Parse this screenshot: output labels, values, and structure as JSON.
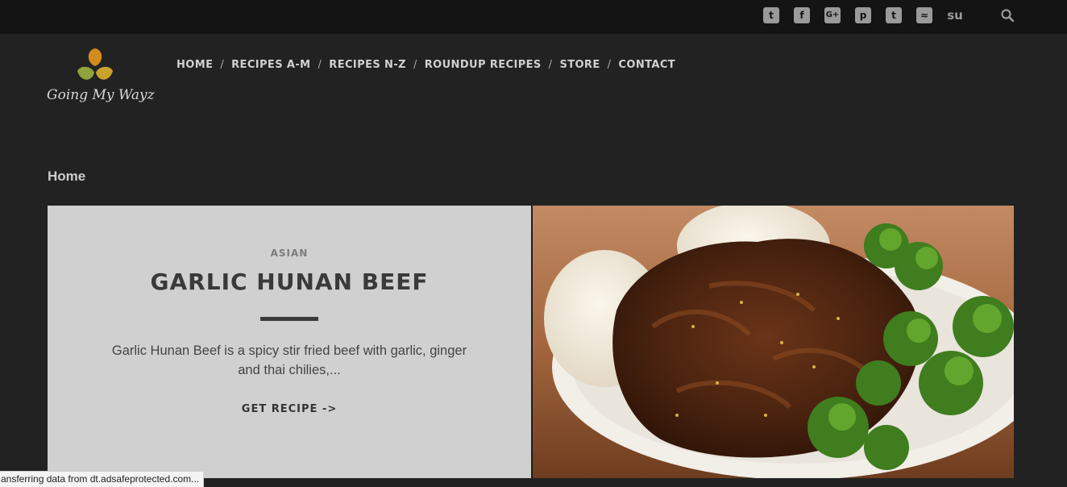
{
  "site": {
    "name": "Going My Wayz"
  },
  "social_icons": [
    {
      "name": "twitter-icon",
      "glyph": "t"
    },
    {
      "name": "facebook-icon",
      "glyph": "f"
    },
    {
      "name": "google-plus-icon",
      "glyph": "G+"
    },
    {
      "name": "pinterest-icon",
      "glyph": "p"
    },
    {
      "name": "tumblr-icon",
      "glyph": "t"
    },
    {
      "name": "rss-icon",
      "glyph": "≈"
    },
    {
      "name": "stumbleupon-icon",
      "glyph": "su"
    }
  ],
  "nav": {
    "items": [
      "HOME",
      "RECIPES A-M",
      "RECIPES N-Z",
      "ROUNDUP RECIPES",
      "STORE",
      "CONTACT"
    ],
    "separator": "/"
  },
  "breadcrumb": "Home",
  "featured": {
    "category": "ASIAN",
    "title": "GARLIC HUNAN BEEF",
    "excerpt": "Garlic Hunan Beef is a spicy stir fried beef with garlic, ginger and thai chilies,...",
    "cta": "GET RECIPE ->"
  },
  "status_bar": "ansferring data from dt.adsafeprotected.com...",
  "colors": {
    "topbar": "#141414",
    "page_bg": "#222222",
    "card_bg": "#d0d0d0",
    "logo_orange": "#d38a1e",
    "logo_green": "#8fa43a",
    "logo_gold": "#c9a22c"
  }
}
